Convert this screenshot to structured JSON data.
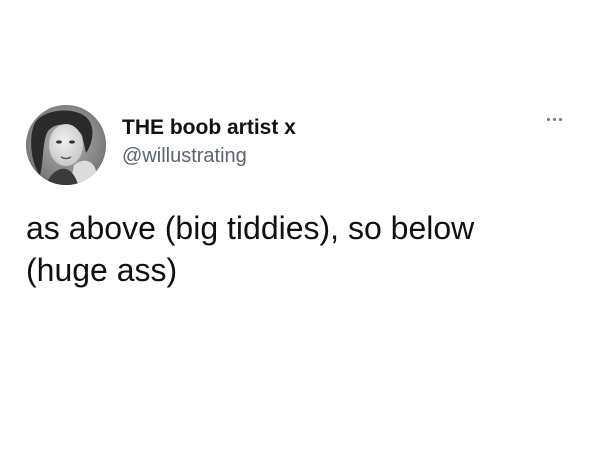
{
  "author": {
    "display_name": "THE boob artist x",
    "handle": "@willustrating"
  },
  "tweet": {
    "line1": "as above (big tiddies), so below",
    "line2": "(huge ass)"
  },
  "icons": {
    "avatar": "profile-photo",
    "more": "more-options-icon"
  },
  "colors": {
    "background": "#ffffff",
    "text": "#111111",
    "handle": "#5b6470"
  }
}
